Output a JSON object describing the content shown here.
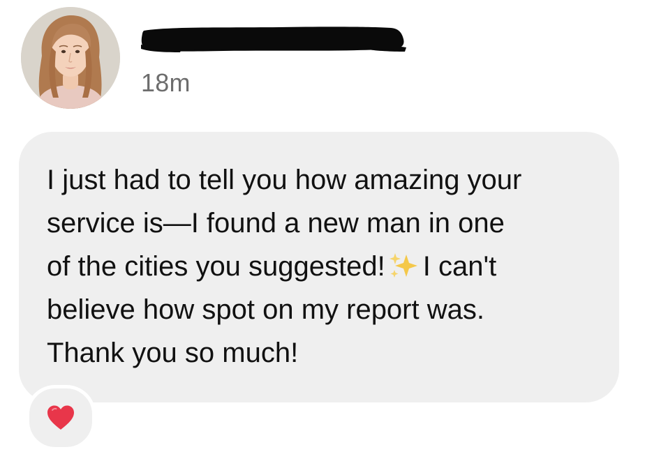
{
  "message_card": {
    "sender": {
      "avatar_icon": "profile-photo",
      "name_redacted": true
    },
    "timestamp": "18m",
    "message": {
      "line1": "I just had to tell you how amazing your",
      "line2": "service is—I found a new man in one",
      "line3a": "of the cities you suggested!",
      "line3_emoji_icon": "sparkles-emoji",
      "line3b": "I can't",
      "line4": "believe how spot on my report was.",
      "line5": "Thank you so much!"
    },
    "reaction": {
      "icon": "red-heart-emoji"
    }
  },
  "colors": {
    "bubble_bg": "#efefef",
    "text": "#111111",
    "timestamp": "#6d6d6d",
    "heart": "#e8364a",
    "sparkle": "#f4c84a"
  }
}
